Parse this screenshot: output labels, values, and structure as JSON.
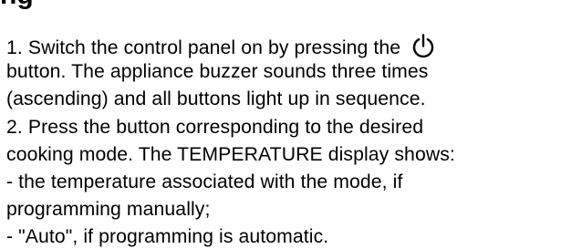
{
  "heading_fragment": "ng",
  "icons": {
    "power": "power-icon"
  },
  "lines": [
    {
      "before_icon": "1. Switch the control panel on by pressing the",
      "icon": "power-icon"
    },
    {
      "text": "button. The appliance buzzer sounds three times"
    },
    {
      "text": "(ascending) and all buttons light up in sequence."
    },
    {
      "text": "2. Press the button corresponding to the desired"
    },
    {
      "text": "cooking mode. The TEMPERATURE display shows:"
    },
    {
      "text": "- the temperature associated with the mode, if"
    },
    {
      "text": "programming manually;"
    },
    {
      "text": "- \"Auto\", if programming is automatic."
    }
  ]
}
